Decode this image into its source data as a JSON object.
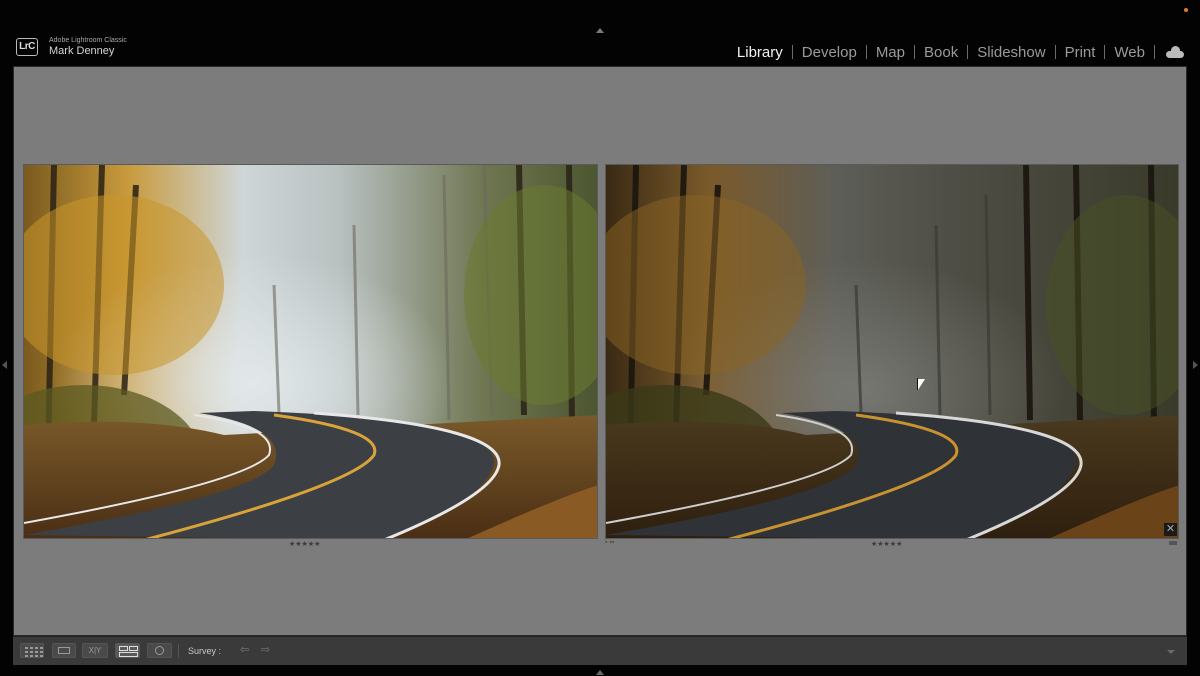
{
  "identity": {
    "logo_text": "LrC",
    "app_name": "Adobe Lightroom Classic",
    "user_name": "Mark Denney"
  },
  "modules": [
    {
      "label": "Library",
      "active": true
    },
    {
      "label": "Develop",
      "active": false
    },
    {
      "label": "Map",
      "active": false
    },
    {
      "label": "Book",
      "active": false
    },
    {
      "label": "Slideshow",
      "active": false
    },
    {
      "label": "Print",
      "active": false
    },
    {
      "label": "Web",
      "active": false
    }
  ],
  "cloud_icon": "cloud-icon",
  "photos": [
    {
      "rating": "★★★★★",
      "variant": "bright-fog-autumn-road"
    },
    {
      "rating": "★★★★★",
      "variant": "dark-fog-autumn-road"
    }
  ],
  "toolbar": {
    "xy_label": "X|Y",
    "survey_label": "Survey :",
    "prev_label": "⇦",
    "next_label": "⇨",
    "close_label": "✕"
  },
  "colors": {
    "accent_dot": "#e0782c",
    "background": "#7c7c7c",
    "toolbar": "#3a3a3a"
  }
}
